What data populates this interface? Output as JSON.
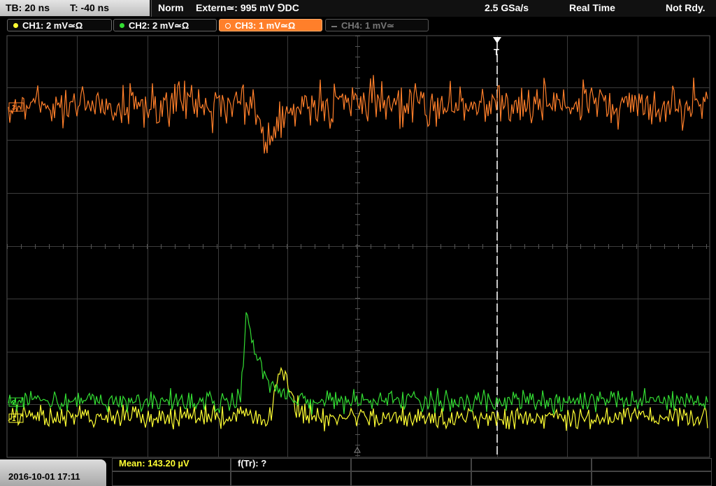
{
  "top": {
    "tb": "TB: 20 ns",
    "t": "T: -40 ns",
    "mode": "Norm",
    "trigger": "Extern≃: 995 mV ⅁DC",
    "rate": "2.5 GSa/s",
    "realtime": "Real Time",
    "status": "Not Rdy."
  },
  "channels": [
    {
      "label": "CH1: 2 mV≃Ω",
      "color": "#ffff33",
      "active": true
    },
    {
      "label": "CH2: 2 mV≃Ω",
      "color": "#33dd33",
      "active": true
    },
    {
      "label": "CH3: 1 mV≃Ω",
      "color": "#ff7f2a",
      "active": true,
      "selected": true
    },
    {
      "label": "CH4: 1 mV≃",
      "color": "#777777",
      "active": false
    }
  ],
  "bottom": {
    "datetime": "2016-10-01 17:11",
    "mean": "Mean: 143.20 µV",
    "ftr": "f(Tr): ?"
  },
  "colors": {
    "ch1": "#ffff33",
    "ch2": "#33dd33",
    "ch3": "#ff7f2a",
    "grid": "#3c3c3c",
    "trigger_marker": "#ffffff"
  },
  "markers": {
    "ch1": "1",
    "ch2": "2",
    "ch3": "3",
    "trigger": "T"
  }
}
